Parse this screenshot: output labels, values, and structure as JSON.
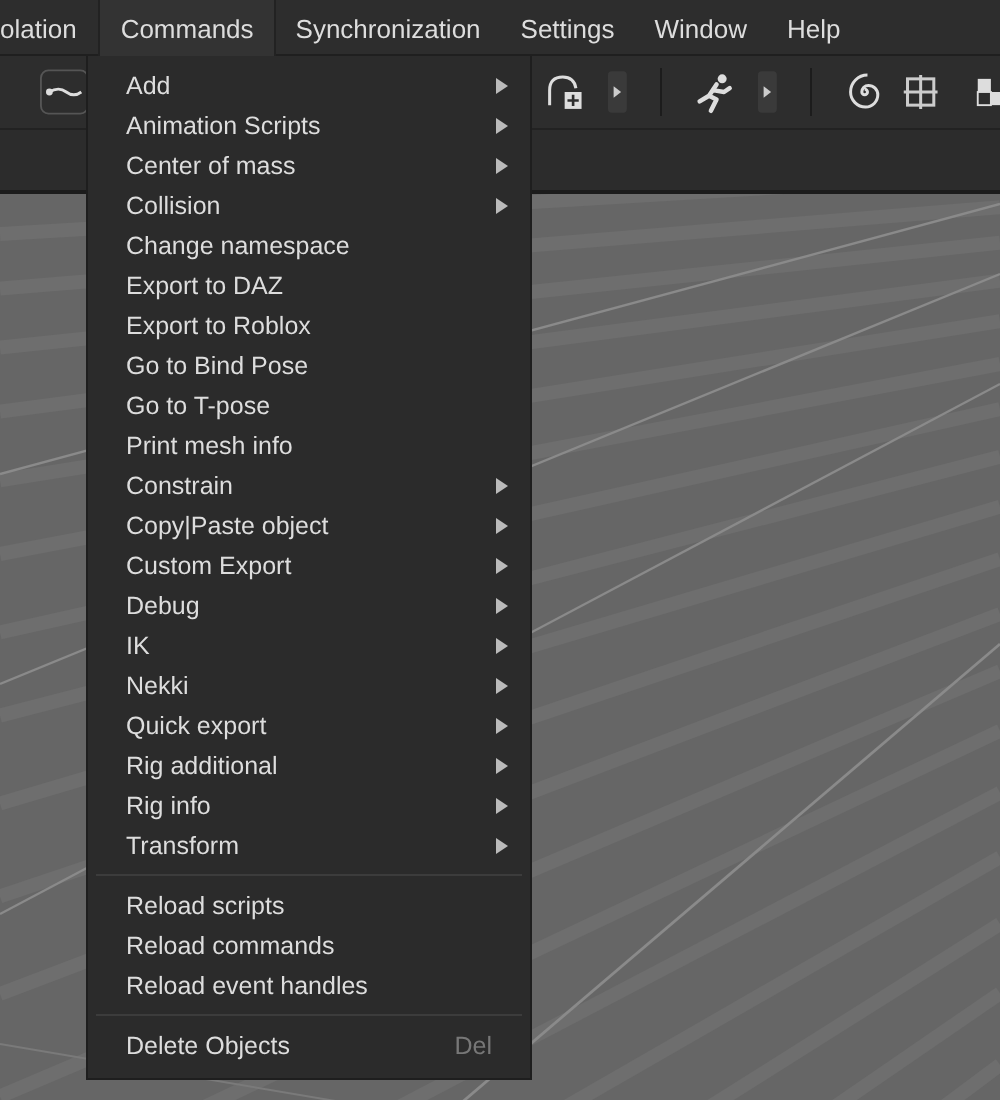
{
  "menubar": [
    {
      "label": "olation",
      "selected": false
    },
    {
      "label": "Commands",
      "selected": true
    },
    {
      "label": "Synchronization",
      "selected": false
    },
    {
      "label": "Settings",
      "selected": false
    },
    {
      "label": "Window",
      "selected": false
    },
    {
      "label": "Help",
      "selected": false
    }
  ],
  "menu": [
    {
      "kind": "item",
      "label": "Add",
      "submenu": true
    },
    {
      "kind": "item",
      "label": "Animation Scripts",
      "submenu": true
    },
    {
      "kind": "item",
      "label": "Center of mass",
      "submenu": true
    },
    {
      "kind": "item",
      "label": "Collision",
      "submenu": true
    },
    {
      "kind": "item",
      "label": "Change namespace",
      "submenu": false
    },
    {
      "kind": "item",
      "label": "Export to DAZ",
      "submenu": false
    },
    {
      "kind": "item",
      "label": "Export to Roblox",
      "submenu": false
    },
    {
      "kind": "item",
      "label": "Go to Bind Pose",
      "submenu": false
    },
    {
      "kind": "item",
      "label": "Go to T-pose",
      "submenu": false
    },
    {
      "kind": "item",
      "label": "Print mesh info",
      "submenu": false
    },
    {
      "kind": "item",
      "label": "Constrain",
      "submenu": true
    },
    {
      "kind": "item",
      "label": "Copy|Paste object",
      "submenu": true
    },
    {
      "kind": "item",
      "label": "Custom Export",
      "submenu": true
    },
    {
      "kind": "item",
      "label": "Debug",
      "submenu": true
    },
    {
      "kind": "item",
      "label": "IK",
      "submenu": true
    },
    {
      "kind": "item",
      "label": "Nekki",
      "submenu": true
    },
    {
      "kind": "item",
      "label": "Quick export",
      "submenu": true
    },
    {
      "kind": "item",
      "label": "Rig additional",
      "submenu": true
    },
    {
      "kind": "item",
      "label": "Rig info",
      "submenu": true
    },
    {
      "kind": "item",
      "label": "Transform",
      "submenu": true
    },
    {
      "kind": "separator"
    },
    {
      "kind": "item",
      "label": "Reload scripts",
      "submenu": false
    },
    {
      "kind": "item",
      "label": "Reload commands",
      "submenu": false
    },
    {
      "kind": "item",
      "label": "Reload event handles",
      "submenu": false
    },
    {
      "kind": "separator"
    },
    {
      "kind": "item",
      "label": "Delete Objects",
      "submenu": false,
      "shortcut": "Del"
    }
  ]
}
